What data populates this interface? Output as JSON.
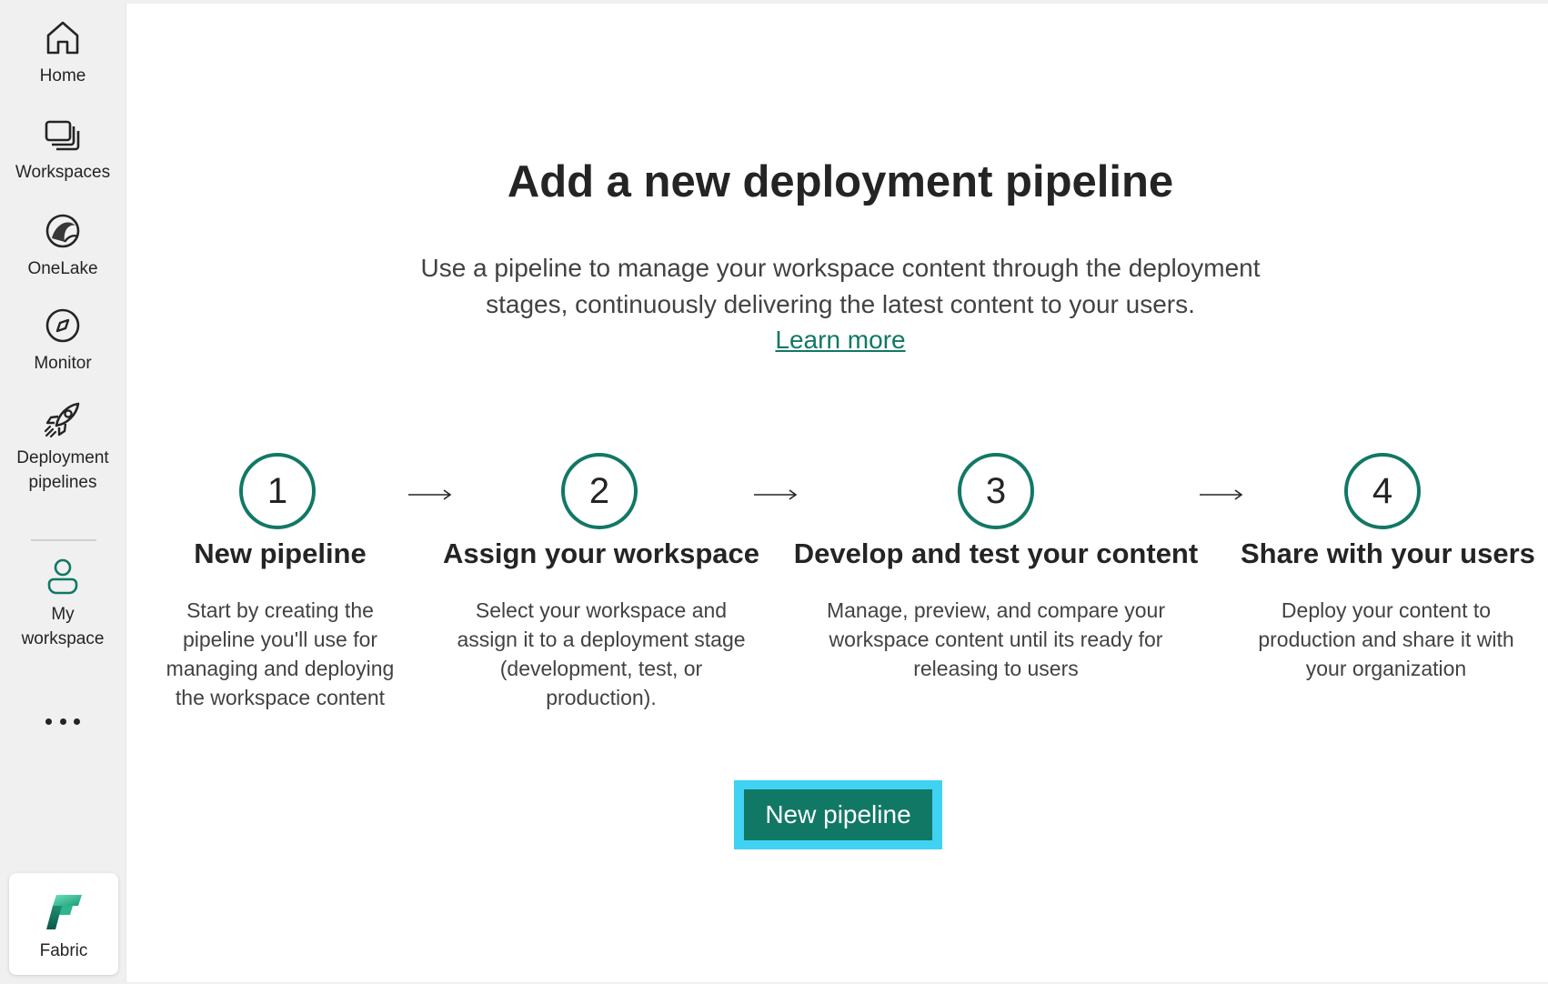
{
  "nav": {
    "home": "Home",
    "workspaces": "Workspaces",
    "onelake": "OneLake",
    "monitor": "Monitor",
    "deployment_line1": "Deployment",
    "deployment_line2": "pipelines",
    "my_line1": "My",
    "my_line2": "workspace",
    "fabric": "Fabric"
  },
  "main": {
    "title": "Add a new deployment pipeline",
    "desc_line1": "Use a pipeline to manage your workspace content through the deployment",
    "desc_line2": "stages, continuously delivering the latest content to your users.",
    "learn_more": "Learn more",
    "button": "New pipeline"
  },
  "steps": [
    {
      "number": "1",
      "title": "New pipeline",
      "desc": [
        "Start by creating the",
        "pipeline you'll use for",
        "managing and deploying",
        "the workspace content"
      ]
    },
    {
      "number": "2",
      "title": "Assign your workspace",
      "desc": [
        "Select your workspace and",
        "assign it to a deployment stage",
        "(development, test, or",
        "production)."
      ]
    },
    {
      "number": "3",
      "title": "Develop and test your content",
      "desc": [
        "Manage, preview, and compare your",
        "workspace content until its ready for",
        "releasing to users"
      ]
    },
    {
      "number": "4",
      "title": "Share with your users",
      "desc": [
        "Deploy your content to",
        "production and share it with",
        "your organization"
      ]
    }
  ],
  "colors": {
    "accent": "#117865",
    "focus": "#3fd2f3"
  }
}
